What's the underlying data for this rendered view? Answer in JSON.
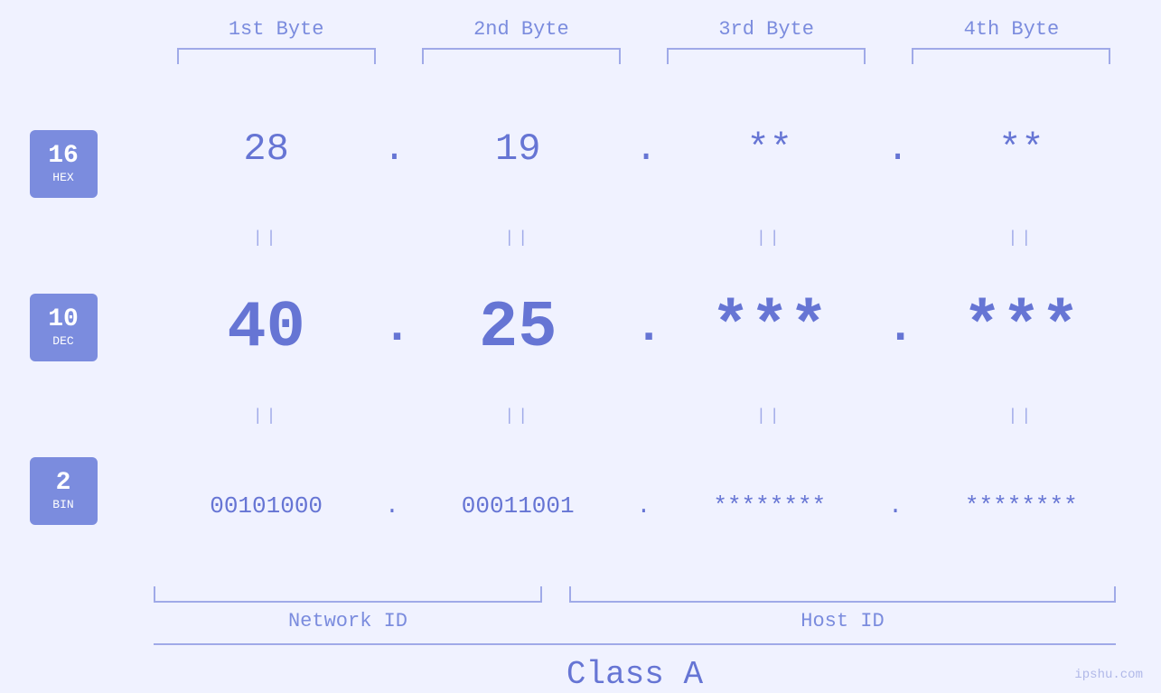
{
  "headers": {
    "byte1": "1st Byte",
    "byte2": "2nd Byte",
    "byte3": "3rd Byte",
    "byte4": "4th Byte"
  },
  "bases": [
    {
      "num": "16",
      "name": "HEX"
    },
    {
      "num": "10",
      "name": "DEC"
    },
    {
      "num": "2",
      "name": "BIN"
    }
  ],
  "rows": {
    "hex": {
      "b1": "28",
      "b2": "19",
      "b3": "**",
      "b4": "**"
    },
    "dec": {
      "b1": "40",
      "b2": "25",
      "b3": "***",
      "b4": "***"
    },
    "bin": {
      "b1": "00101000",
      "b2": "00011001",
      "b3": "********",
      "b4": "********"
    }
  },
  "equals": "||",
  "labels": {
    "network_id": "Network ID",
    "host_id": "Host ID",
    "class": "Class A"
  },
  "watermark": "ipshu.com"
}
